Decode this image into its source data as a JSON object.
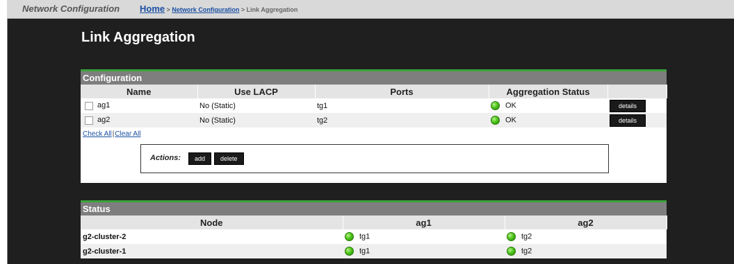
{
  "header": {
    "section_title": "Network Configuration",
    "breadcrumb": {
      "home": "Home",
      "sep1": " > ",
      "network_configuration": "Network Configuration",
      "sep2": " > ",
      "current": "Link Aggregation"
    }
  },
  "page_title": "Link Aggregation",
  "configuration": {
    "title": "Configuration",
    "columns": [
      "Name",
      "Use LACP",
      "Ports",
      "Aggregation Status",
      ""
    ],
    "rows": [
      {
        "name": "ag1",
        "lacp": "No (Static)",
        "ports": "tg1",
        "status": "OK",
        "details": "details"
      },
      {
        "name": "ag2",
        "lacp": "No (Static)",
        "ports": "tg2",
        "status": "OK",
        "details": "details"
      }
    ],
    "check_all": "Check All",
    "separator": "|",
    "clear_all": "Clear All",
    "actions_label": "Actions:",
    "add_label": "add",
    "delete_label": "delete"
  },
  "status": {
    "title": "Status",
    "columns": [
      "Node",
      "ag1",
      "ag2"
    ],
    "rows": [
      {
        "node": "g2-cluster-2",
        "ag1": "tg1",
        "ag2": "tg2"
      },
      {
        "node": "g2-cluster-1",
        "ag1": "tg1",
        "ag2": "tg2"
      }
    ]
  },
  "colors": {
    "status_ok": "#4cc41a",
    "panel_accent": "#3aa33a",
    "link": "#1a4fa3"
  }
}
